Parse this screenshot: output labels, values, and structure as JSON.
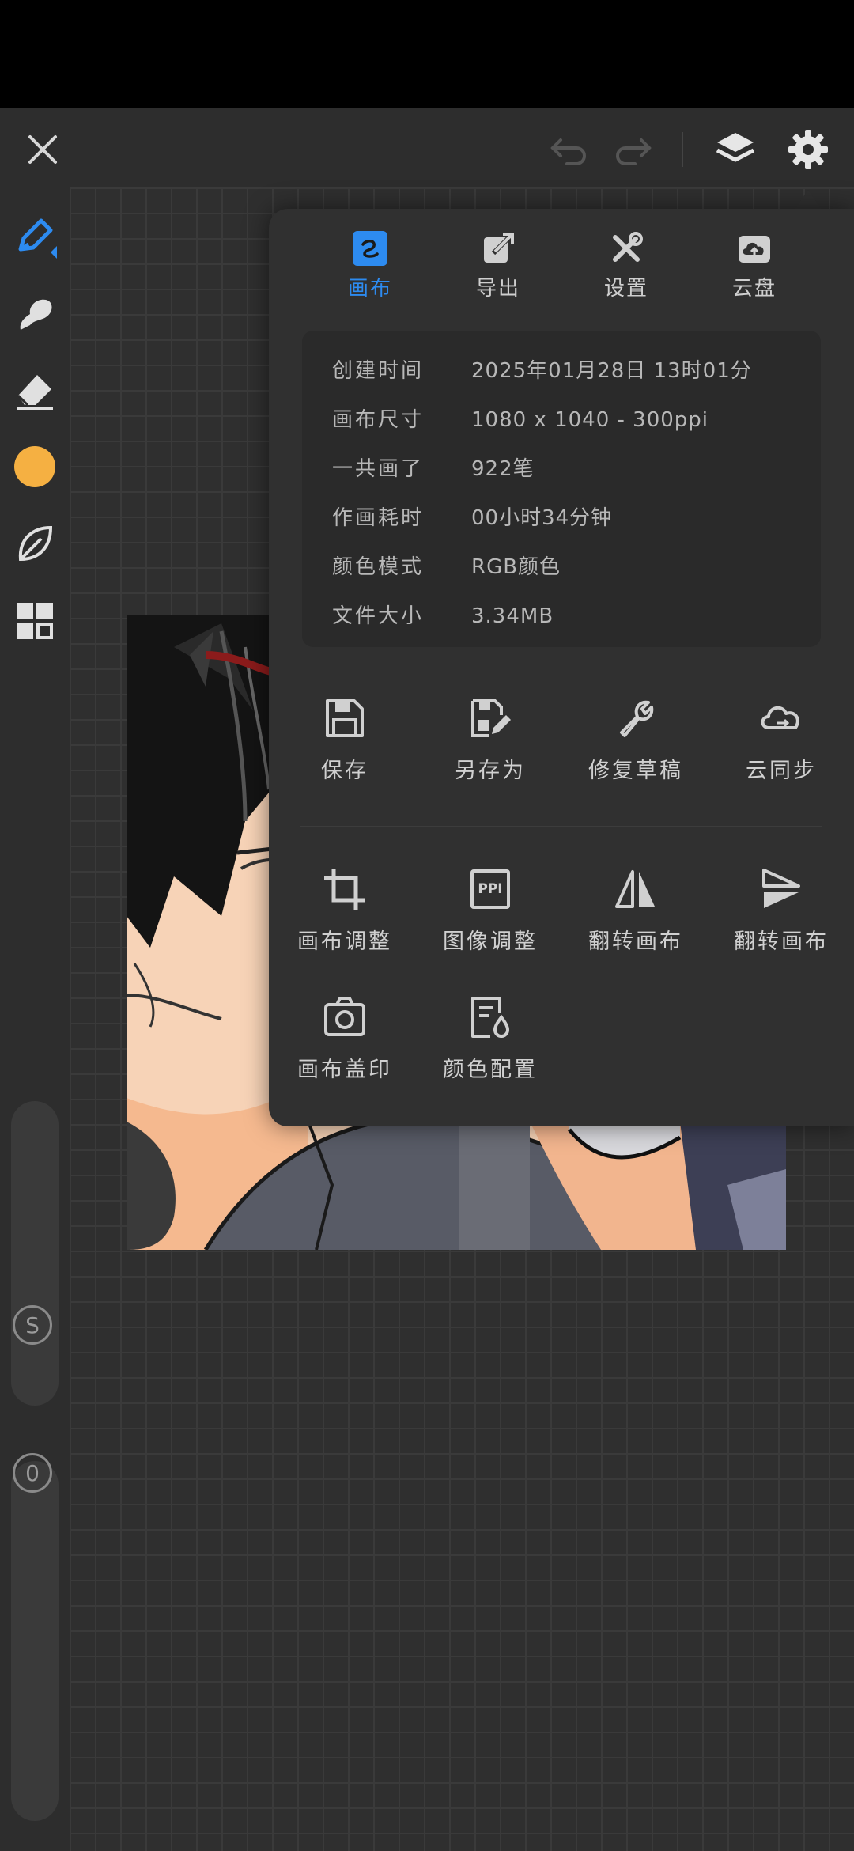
{
  "toolbar": {
    "close_icon": "close-icon",
    "undo_icon": "undo-icon",
    "redo_icon": "redo-icon",
    "layers_icon": "layers-icon",
    "settings_icon": "gear-icon"
  },
  "left_tools": {
    "items": [
      "pen-icon",
      "smudge-icon",
      "eraser-icon",
      "color-swatch",
      "leaf-icon",
      "grid-icon"
    ],
    "active_color": "#f5b042",
    "accent_color": "#2d8bf0",
    "size_knob_label": "S",
    "opacity_knob_label": "0"
  },
  "panel": {
    "tabs": [
      {
        "label": "画布",
        "icon": "canvas-icon"
      },
      {
        "label": "导出",
        "icon": "export-icon"
      },
      {
        "label": "设置",
        "icon": "tools-icon"
      },
      {
        "label": "云盘",
        "icon": "cloud-drive-icon"
      }
    ],
    "info": [
      {
        "key": "创建时间",
        "value": "2025年01月28日 13时01分"
      },
      {
        "key": "画布尺寸",
        "value": "1080 x 1040 - 300ppi"
      },
      {
        "key": "一共画了",
        "value": "922笔"
      },
      {
        "key": "作画耗时",
        "value": "00小时34分钟"
      },
      {
        "key": "颜色模式",
        "value": "RGB颜色"
      },
      {
        "key": "文件大小",
        "value": "3.34MB"
      }
    ],
    "actions_row1": [
      {
        "label": "保存",
        "icon": "save-icon"
      },
      {
        "label": "另存为",
        "icon": "save-as-icon"
      },
      {
        "label": "修复草稿",
        "icon": "wrench-icon"
      },
      {
        "label": "云同步",
        "icon": "cloud-sync-icon"
      }
    ],
    "actions_row2": [
      {
        "label": "画布调整",
        "icon": "crop-icon"
      },
      {
        "label": "图像调整",
        "icon": "ppi-icon"
      },
      {
        "label": "翻转画布",
        "icon": "flip-horizontal-icon"
      },
      {
        "label": "翻转画布",
        "icon": "flip-vertical-icon"
      }
    ],
    "actions_row3": [
      {
        "label": "画布盖印",
        "icon": "camera-icon"
      },
      {
        "label": "颜色配置",
        "icon": "color-profile-icon"
      }
    ],
    "ppi_badge": "PPI"
  }
}
